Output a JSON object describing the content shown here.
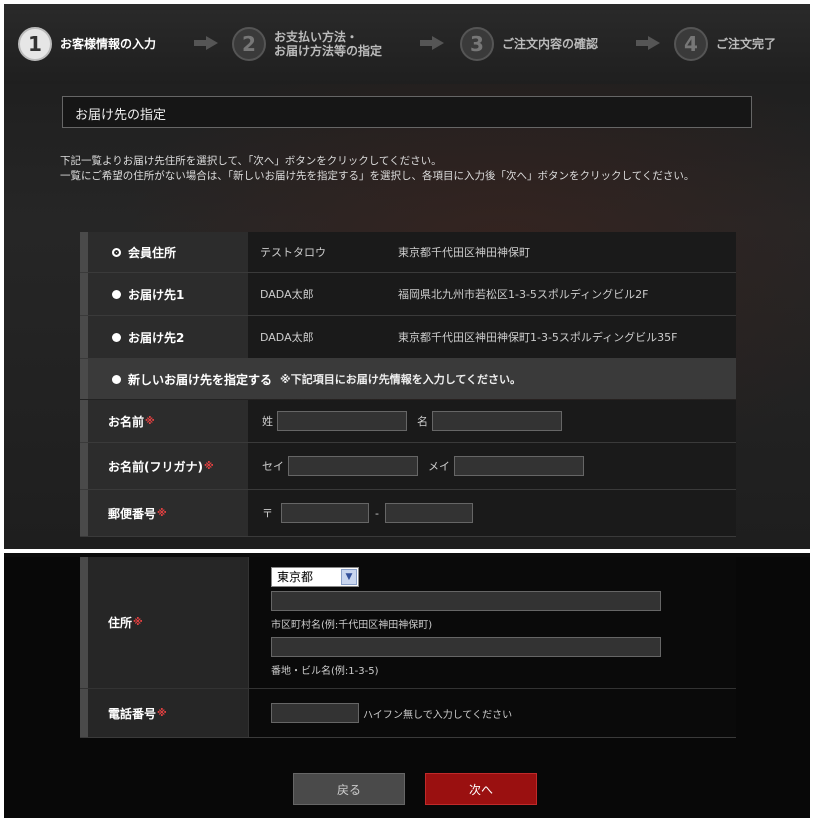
{
  "steps": [
    {
      "num": "1",
      "label": "お客様情報の入力",
      "active": true
    },
    {
      "num": "2",
      "label_line1": "お支払い方法・",
      "label_line2": "お届け方法等の指定",
      "active": false
    },
    {
      "num": "3",
      "label": "ご注文内容の確認",
      "active": false
    },
    {
      "num": "4",
      "label": "ご注文完了",
      "active": false
    }
  ],
  "section": {
    "title": "お届け先の指定"
  },
  "instructions": {
    "line1": "下記一覧よりお届け先住所を選択して、「次へ」ボタンをクリックしてください。",
    "line2": "一覧にご希望の住所がない場合は、「新しいお届け先を指定する」を選択し、各項目に入力後「次へ」ボタンをクリックしてください。"
  },
  "addresses": [
    {
      "label": "会員住所",
      "name": "テストタロウ",
      "address": "東京都千代田区神田神保町",
      "selected": true
    },
    {
      "label": "お届け先1",
      "name": "DADA太郎",
      "address": "福岡県北九州市若松区1-3-5スポルディングビル2F",
      "selected": false
    },
    {
      "label": "お届け先2",
      "name": "DADA太郎",
      "address": "東京都千代田区神田神保町1-3-5スポルディングビル35F",
      "selected": false
    }
  ],
  "new_address": {
    "label": "新しいお届け先を指定する",
    "note": "※下記項目にお届け先情報を入力してください。"
  },
  "form": {
    "name": {
      "label": "お名前",
      "required": "※",
      "sei": "姓",
      "mei": "名"
    },
    "kana": {
      "label": "お名前(フリガナ)",
      "required": "※",
      "sei": "セイ",
      "mei": "メイ"
    },
    "postal": {
      "label": "郵便番号",
      "required": "※",
      "prefix": "〒",
      "sep": "-"
    },
    "address": {
      "label": "住所",
      "required": "※",
      "prefecture": "東京都",
      "city_hint": "市区町村名(例:千代田区神田神保町)",
      "street_hint": "番地・ビル名(例:1-3-5)"
    },
    "phone": {
      "label": "電話番号",
      "required": "※",
      "hint": "ハイフン無しで入力してください"
    }
  },
  "buttons": {
    "back": "戻る",
    "next": "次へ"
  },
  "colors": {
    "accent": "#9a1010",
    "required": "#e04040"
  }
}
